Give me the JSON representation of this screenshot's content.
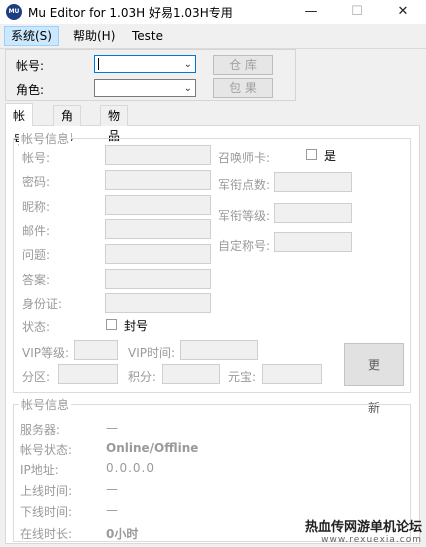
{
  "window": {
    "title": "Mu Editor for 1.03H 好易1.03H专用",
    "icon_text": "MU",
    "minimize": "—",
    "maximize": "☐",
    "close": "✕"
  },
  "menu": {
    "system": "系统(S)",
    "help": "帮助(H)",
    "teste": "Teste"
  },
  "top": {
    "account_label": "帐号:",
    "account_value": "",
    "role_label": "角色:",
    "role_value": "",
    "warehouse_button": "仓 库",
    "bag_button": "包 果"
  },
  "tabs": [
    "帐号",
    "角色",
    "物品"
  ],
  "account_info": {
    "legend": "帐号信息",
    "left_labels": [
      "帐号:",
      "密码:",
      "昵称:",
      "邮件:",
      "问题:",
      "答案:",
      "身份证:"
    ],
    "status_label": "状态:",
    "ban_label": "封号",
    "summoner_label": "召唤师卡:",
    "summoner_yes": "是",
    "right_labels": [
      "军衔点数:",
      "军衔等级:",
      "自定称号:"
    ],
    "vip_level_label": "VIP等级:",
    "vip_time_label": "VIP时间:",
    "zone_label": "分区:",
    "points_label": "积分:",
    "gem_label": "元宝:",
    "update_button": "更新"
  },
  "server_info": {
    "legend": "帐号信息",
    "rows": [
      {
        "label": "服务器:",
        "value": "—"
      },
      {
        "label": "帐号状态:",
        "value": "Online/Offline"
      },
      {
        "label": "IP地址:",
        "value": "0.0.0.0"
      },
      {
        "label": "上线时间:",
        "value": "—"
      },
      {
        "label": "下线时间:",
        "value": "—"
      },
      {
        "label": "在线时长:",
        "value": "0小时"
      }
    ]
  },
  "watermark": {
    "line1": "热血传网游单机论坛",
    "line2": "www.rexuexia.com"
  }
}
